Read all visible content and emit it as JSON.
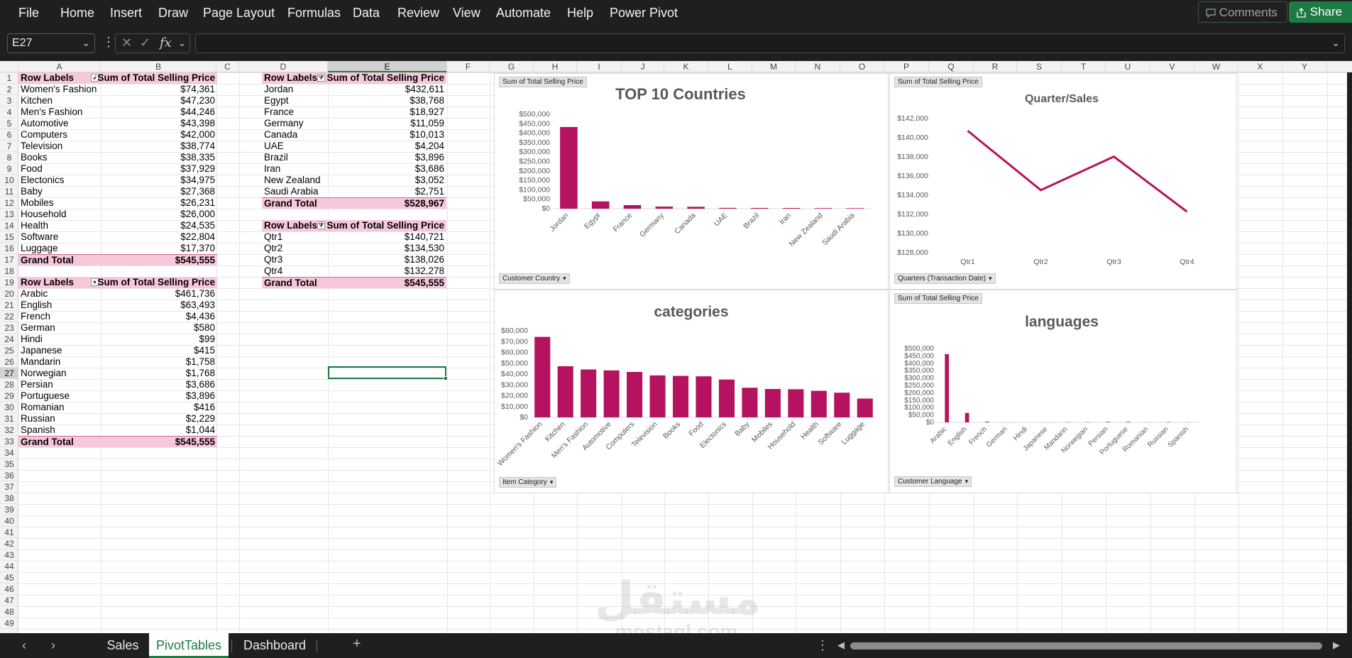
{
  "menu": [
    "File",
    "Home",
    "Insert",
    "Draw",
    "Page Layout",
    "Formulas",
    "Data",
    "Review",
    "View",
    "Automate",
    "Help",
    "Power Pivot"
  ],
  "toolbar": {
    "comments_label": "Comments",
    "share_label": "Share"
  },
  "formula_bar": {
    "name_box": "E27",
    "fx_label": "fx",
    "value": ""
  },
  "columns": [
    "A",
    "B",
    "C",
    "D",
    "E",
    "F",
    "G",
    "H",
    "I",
    "J",
    "K",
    "L",
    "M",
    "N",
    "O",
    "P",
    "Q",
    "R",
    "S",
    "T",
    "U",
    "V",
    "W",
    "X",
    "Y"
  ],
  "rows_count": 49,
  "pivot_categories": {
    "header_label": "Row Labels",
    "header_value": "Sum of Total Selling Price",
    "rows": [
      {
        "label": "Women's Fashion",
        "value": "$74,361"
      },
      {
        "label": "Kitchen",
        "value": "$47,230"
      },
      {
        "label": "Men's Fashion",
        "value": "$44,246"
      },
      {
        "label": "Automotive",
        "value": "$43,398"
      },
      {
        "label": "Computers",
        "value": "$42,000"
      },
      {
        "label": "Television",
        "value": "$38,774"
      },
      {
        "label": "Books",
        "value": "$38,335"
      },
      {
        "label": "Food",
        "value": "$37,929"
      },
      {
        "label": "Electonics",
        "value": "$34,975"
      },
      {
        "label": "Baby",
        "value": "$27,368"
      },
      {
        "label": "Mobiles",
        "value": "$26,231"
      },
      {
        "label": "Household",
        "value": "$26,000"
      },
      {
        "label": "Health",
        "value": "$24,535"
      },
      {
        "label": "Software",
        "value": "$22,804"
      },
      {
        "label": "Luggage",
        "value": "$17,370"
      }
    ],
    "total_label": "Grand Total",
    "total_value": "$545,555"
  },
  "pivot_languages": {
    "header_label": "Row Labels",
    "header_value": "Sum of Total Selling Price",
    "rows": [
      {
        "label": "Arabic",
        "value": "$461,736"
      },
      {
        "label": "English",
        "value": "$63,493"
      },
      {
        "label": "French",
        "value": "$4,436"
      },
      {
        "label": "German",
        "value": "$580"
      },
      {
        "label": "Hindi",
        "value": "$99"
      },
      {
        "label": "Japanese",
        "value": "$415"
      },
      {
        "label": "Mandarin",
        "value": "$1,758"
      },
      {
        "label": "Norwegian",
        "value": "$1,768"
      },
      {
        "label": "Persian",
        "value": "$3,686"
      },
      {
        "label": "Portuguese",
        "value": "$3,896"
      },
      {
        "label": "Romanian",
        "value": "$416"
      },
      {
        "label": "Russian",
        "value": "$2,229"
      },
      {
        "label": "Spanish",
        "value": "$1,044"
      }
    ],
    "total_label": "Grand Total",
    "total_value": "$545,555"
  },
  "pivot_countries": {
    "header_label": "Row Labels",
    "header_value": "Sum of Total Selling Price",
    "rows": [
      {
        "label": "Jordan",
        "value": "$432,611"
      },
      {
        "label": "Egypt",
        "value": "$38,768"
      },
      {
        "label": "France",
        "value": "$18,927"
      },
      {
        "label": "Germany",
        "value": "$11,059"
      },
      {
        "label": "Canada",
        "value": "$10,013"
      },
      {
        "label": "UAE",
        "value": "$4,204"
      },
      {
        "label": "Brazil",
        "value": "$3,896"
      },
      {
        "label": "Iran",
        "value": "$3,686"
      },
      {
        "label": "New Zealand",
        "value": "$3,052"
      },
      {
        "label": "Saudi Arabia",
        "value": "$2,751"
      }
    ],
    "total_label": "Grand Total",
    "total_value": "$528,967"
  },
  "pivot_quarters": {
    "header_label": "Row Labels",
    "header_value": "Sum of Total Selling Price",
    "rows": [
      {
        "label": "Qtr1",
        "value": "$140,721"
      },
      {
        "label": "Qtr2",
        "value": "$134,530"
      },
      {
        "label": "Qtr3",
        "value": "$138,026"
      },
      {
        "label": "Qtr4",
        "value": "$132,278"
      }
    ],
    "total_label": "Grand Total",
    "total_value": "$545,555"
  },
  "chart_data": [
    {
      "type": "bar",
      "title": "TOP 10 Countries",
      "value_field": "Sum of Total Selling Price",
      "axis_field": "Customer Country",
      "categories": [
        "Jordan",
        "Egypt",
        "France",
        "Germany",
        "Canada",
        "UAE",
        "Brazil",
        "Iran",
        "New Zealand",
        "Saudi Arabia"
      ],
      "values": [
        432611,
        38768,
        18927,
        11059,
        10013,
        4204,
        3896,
        3686,
        3052,
        2751
      ],
      "ylim": [
        0,
        500000
      ],
      "yticks": [
        "$0",
        "$50,000",
        "$100,000",
        "$150,000",
        "$200,000",
        "$250,000",
        "$300,000",
        "$350,000",
        "$400,000",
        "$450,000",
        "$500,000"
      ],
      "color": "#b5135f"
    },
    {
      "type": "line",
      "title": "Quarter/Sales",
      "value_field": "Sum of Total Selling Price",
      "axis_field": "Quarters (Transaction Date)",
      "categories": [
        "Qtr1",
        "Qtr2",
        "Qtr3",
        "Qtr4"
      ],
      "values": [
        140721,
        134530,
        138026,
        132278
      ],
      "ylim": [
        128000,
        142000
      ],
      "yticks": [
        "$128,000",
        "$130,000",
        "$132,000",
        "$134,000",
        "$136,000",
        "$138,000",
        "$140,000",
        "$142,000"
      ],
      "color": "#b5135f"
    },
    {
      "type": "bar",
      "title": "categories",
      "axis_field": "Item Category",
      "categories": [
        "Women's Fashion",
        "Kitchen",
        "Men's Fashion",
        "Automotive",
        "Computers",
        "Television",
        "Books",
        "Food",
        "Electonics",
        "Baby",
        "Mobiles",
        "Household",
        "Health",
        "Software",
        "Luggage"
      ],
      "values": [
        74361,
        47230,
        44246,
        43398,
        42000,
        38774,
        38335,
        37929,
        34975,
        27368,
        26231,
        26000,
        24535,
        22804,
        17370
      ],
      "ylim": [
        0,
        80000
      ],
      "yticks": [
        "$0",
        "$10,000",
        "$20,000",
        "$30,000",
        "$40,000",
        "$50,000",
        "$60,000",
        "$70,000",
        "$80,000"
      ],
      "color": "#b5135f"
    },
    {
      "type": "bar",
      "title": "languages",
      "value_field": "Sum of Total Selling Price",
      "axis_field": "Customer Language",
      "categories": [
        "Arabic",
        "English",
        "French",
        "German",
        "Hindi",
        "Japanese",
        "Mandarin",
        "Norwegian",
        "Persian",
        "Portuguese",
        "Romanian",
        "Russian",
        "Spanish"
      ],
      "values": [
        461736,
        63493,
        4436,
        580,
        99,
        415,
        1758,
        1768,
        3686,
        3896,
        416,
        2229,
        1044
      ],
      "ylim": [
        0,
        500000
      ],
      "yticks": [
        "$0",
        "$50,000",
        "$100,000",
        "$150,000",
        "$200,000",
        "$250,000",
        "$300,000",
        "$350,000",
        "$400,000",
        "$450,000",
        "$500,000"
      ],
      "color": "#b5135f"
    }
  ],
  "watermark": {
    "arabic": "مستقل",
    "latin": "mostaql.com"
  },
  "sheets": [
    {
      "name": "Sales",
      "active": false
    },
    {
      "name": "PivotTables",
      "active": true
    },
    {
      "name": "Dashboard",
      "active": false
    }
  ],
  "icons": {
    "add_sheet": "plus-icon",
    "prev": "chevron-left-icon",
    "next": "chevron-right-icon"
  }
}
